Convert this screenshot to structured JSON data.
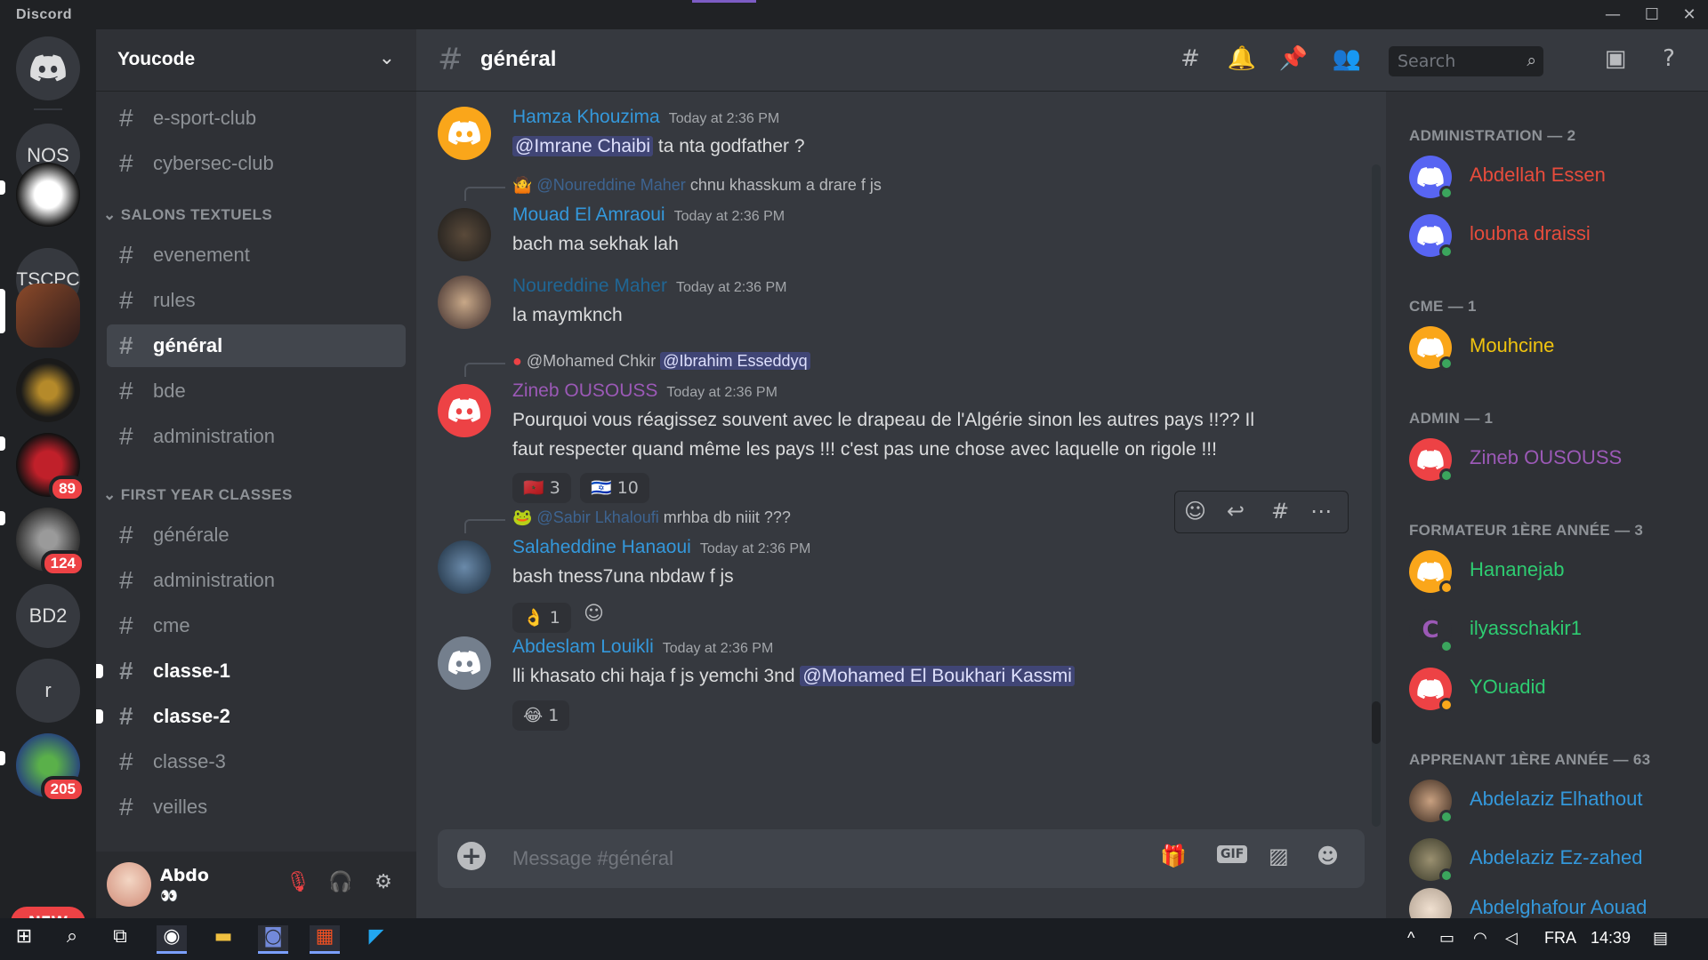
{
  "window": {
    "brand": "Discord"
  },
  "guilds": [
    {
      "label": "",
      "kind": "home"
    },
    {
      "label": "NOS"
    },
    {
      "label": "",
      "kind": "photo"
    },
    {
      "label": "TSCPC"
    },
    {
      "label": "",
      "kind": "photo"
    },
    {
      "label": "",
      "kind": "photo"
    },
    {
      "label": "",
      "kind": "photo",
      "badge": "89"
    },
    {
      "label": "",
      "kind": "photo",
      "badge": "124"
    },
    {
      "label": "BD2"
    },
    {
      "label": "r"
    },
    {
      "label": "",
      "kind": "photo",
      "badge": "205"
    }
  ],
  "guild_new": "NEW",
  "server": {
    "name": "Youcode"
  },
  "channels_top": [
    {
      "name": "e-sport-club"
    },
    {
      "name": "cybersec-club"
    }
  ],
  "categories": {
    "text": "SALONS TEXTUELS",
    "first": "FIRST YEAR CLASSES"
  },
  "text_channels": [
    {
      "name": "evenement"
    },
    {
      "name": "rules"
    },
    {
      "name": "général",
      "active": true
    },
    {
      "name": "bde"
    },
    {
      "name": "administration"
    }
  ],
  "class_channels": [
    {
      "name": "générale"
    },
    {
      "name": "administration"
    },
    {
      "name": "cme"
    },
    {
      "name": "classe-1",
      "unread": true
    },
    {
      "name": "classe-2",
      "unread": true
    },
    {
      "name": "classe-3"
    },
    {
      "name": "veilles"
    }
  ],
  "user": {
    "name": "Abdo",
    "status": "👀"
  },
  "header": {
    "channel": "général",
    "search_placeholder": "Search"
  },
  "messages": [
    {
      "author": "Hamza Khouzima",
      "color": "#3498db",
      "time": "Today at 2:36 PM",
      "mention": "@Imrane Chaibi",
      "text": "ta nta godfather ?"
    },
    {
      "reply_to": "@Noureddine Maher",
      "reply_text": "chnu khasskum a drare f js",
      "author": "Mouad El Amraoui",
      "color": "#3498db",
      "time": "Today at 2:36 PM",
      "text": "bach ma sekhak lah"
    },
    {
      "author": "Noureddine Maher",
      "color": "#206694",
      "time": "Today at 2:36 PM",
      "text": "la maymknch"
    },
    {
      "reply_to": "@Mohamed Chkir",
      "reply_mention": "@Ibrahim Esseddyq",
      "author": "Zineb OUSOUSS",
      "color": "#9b59b6",
      "time": "Today at 2:36 PM",
      "text_1": "Pourquoi vous réagissez souvent avec le drapeau de l'Algérie sinon les autres pays !!?? Il",
      "text_2": "faut respecter quand même les pays !!! c'est pas une chose avec laquelle on rigole !!!",
      "reactions": [
        {
          "emoji": "🇲🇦",
          "count": "3"
        },
        {
          "emoji": "🇮🇱",
          "count": "10"
        }
      ]
    },
    {
      "reply_to": "@Sabir Lkhaloufi",
      "reply_text": "mrhba db niiit ???",
      "author": "Salaheddine Hanaoui",
      "color": "#3498db",
      "time": "Today at 2:36 PM",
      "text": "bash tness7una nbdaw f js",
      "reactions": [
        {
          "emoji": "👌",
          "count": "1"
        }
      ]
    },
    {
      "author": "Abdeslam Louikli",
      "color": "#3498db",
      "time": "Today at 2:36 PM",
      "text": "lli khasato chi haja f js yemchi 3nd",
      "mention": "@Mohamed El Boukhari Kassmi",
      "reactions": [
        {
          "emoji": "😂",
          "count": "1"
        }
      ]
    }
  ],
  "composer": {
    "placeholder": "Message #général",
    "gif": "GIF"
  },
  "members": {
    "roles": [
      {
        "title": "ADMINISTRATION — 2",
        "members": [
          {
            "name": "Abdellah Essen",
            "color": "#e74c3c",
            "avatar": "#5865f2",
            "status": "online"
          },
          {
            "name": "loubna draissi",
            "color": "#e74c3c",
            "avatar": "#5865f2",
            "status": "online"
          }
        ]
      },
      {
        "title": "CME — 1",
        "members": [
          {
            "name": "Mouhcine",
            "color": "#f1c40f",
            "avatar": "#faa61a",
            "status": "online"
          }
        ]
      },
      {
        "title": "ADMIN — 1",
        "members": [
          {
            "name": "Zineb OUSOUSS",
            "color": "#9b59b6",
            "avatar": "#ed4245",
            "status": "online"
          }
        ]
      },
      {
        "title": "FORMATEUR 1ÈRE ANNÉE — 3",
        "members": [
          {
            "name": "Hananejab",
            "color": "#2ecc71",
            "avatar": "#faa61a",
            "status": "idle"
          },
          {
            "name": "ilyasschakir1",
            "color": "#2ecc71",
            "avatar": "#2f3136",
            "status": "online"
          },
          {
            "name": "YOuadid",
            "color": "#2ecc71",
            "avatar": "#ed4245",
            "status": "idle"
          }
        ]
      },
      {
        "title": "APPRENANT 1ÈRE ANNÉE — 63",
        "members": [
          {
            "name": "Abdelaziz Elhathout",
            "color": "#3498db",
            "avatar": "#6b5a4a",
            "status": "online"
          },
          {
            "name": "Abdelaziz Ez-zahed",
            "color": "#3498db",
            "avatar": "#6b6a4a",
            "status": "online"
          },
          {
            "name": "Abdelghafour Aouad",
            "color": "#3498db",
            "avatar": "#c8b8a8",
            "status": "online"
          }
        ]
      }
    ]
  },
  "taskbar": {
    "lang": "FRA",
    "time": "14:39"
  }
}
